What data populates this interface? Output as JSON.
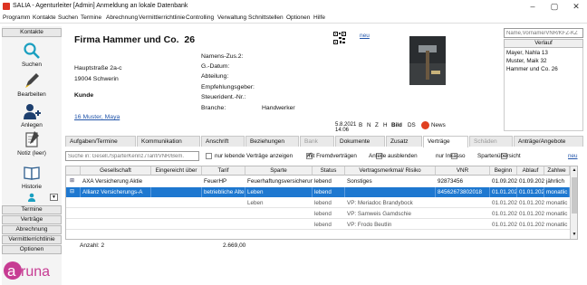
{
  "window": {
    "title": "SALIA - Agenturleiter [Admin] Anmeldung an lokale Datenbank"
  },
  "menu": [
    "Programm",
    "Kontakte",
    "Suchen",
    "Termine",
    "Abrechnung",
    "Vermittlerrichtlinie",
    "Controlling",
    "Verwaltung",
    "Schnittstellen",
    "Optionen",
    "Hilfe"
  ],
  "sidebar": {
    "top_header": "Kontakte",
    "items": [
      {
        "label": "Suchen",
        "icon": "search-icon"
      },
      {
        "label": "Bearbeiten",
        "icon": "pencil-icon"
      },
      {
        "label": "Anlegen",
        "icon": "add-person-icon"
      },
      {
        "label": "Notiz (leer)",
        "icon": "note-icon"
      },
      {
        "label": "Historie",
        "icon": "book-icon"
      }
    ],
    "bottom_buttons": [
      "Termine",
      "Verträge",
      "Abrechnung",
      "Vermittlerrichtlinie",
      "Optionen"
    ],
    "logo_text": "aruna"
  },
  "contact": {
    "company": "Firma Hammer und Co.",
    "number": "26",
    "street": "Hauptstraße 2a-c",
    "city": "19004 Schwerin",
    "role": "Kunde",
    "agent_link": "16 Muster, Maya",
    "fields": [
      "Namens-Zus.2:",
      "G.-Datum:",
      "Abteilung:",
      "Empfehlungsgeber:",
      "Steuerident.-Nr.:",
      "Branche:"
    ],
    "branche_value": "Handwerker",
    "date": "5.8.2021 14:06"
  },
  "photo": {
    "new_link": "neu",
    "buttons": [
      "B",
      "N",
      "Z",
      "H",
      "Bild",
      "DS"
    ],
    "news_label": "News"
  },
  "search": {
    "placeholder": "Name,Vorname/VNR/KFZ-KZ",
    "history_label": "Verlauf",
    "history": [
      "Mayer, Nahla  13",
      "Muster, Maik  32",
      "Hammer und Co.  26"
    ]
  },
  "tabs": [
    "Aufgaben/Termine",
    "Kommunikation",
    "Anschrift",
    "Beziehungen",
    "Bank",
    "Dokumente",
    "Zusatz",
    "Verträge",
    "Schäden",
    "Anträge/Angebote"
  ],
  "active_tab": "Verträge",
  "filters": {
    "search_placeholder": "Suche in: Gesell./Sparte/Kennz./Tarif/VNR/Bem.",
    "opt_active": "nur lebende Verträge anzeigen",
    "opt_fremd": "mit Fremdverträgen",
    "opt_anteile": "Anteile ausblenden",
    "opt_inkasso": "nur Inkasso",
    "opt_sparten": "Spartenübersicht",
    "new_link": "neu"
  },
  "grid": {
    "headers": [
      "Gesellschaft",
      "Eingereicht über",
      "Tarif",
      "Sparte",
      "Status",
      "Vertragsmerkmal/ Risiko",
      "VNR",
      "Beginn",
      "Ablauf",
      "Zahlwe"
    ],
    "rows": [
      {
        "gesellschaft": "AXA Versicherung Aktie",
        "eingereicht": "",
        "tarif": "FeuerHP",
        "sparte": "Feuerhaftungsversicherun",
        "status": "lebend",
        "merkmal": "Sonstiges",
        "vnr": "92873456",
        "beginn": "01.09.2020",
        "ablauf": "01.09.2021",
        "zahlweise": "jährlich",
        "selected": false,
        "sub": false
      },
      {
        "gesellschaft": "Allianz Versicherungs-A",
        "eingereicht": "",
        "tarif": "betriebliche Alte",
        "sparte": "Leben",
        "status": "lebend",
        "merkmal": "",
        "vnr": "84562673802018",
        "beginn": "01.01.2021",
        "ablauf": "01.01.2022",
        "zahlweise": "monatlic",
        "selected": true,
        "sub": false
      },
      {
        "gesellschaft": "",
        "eingereicht": "",
        "tarif": "",
        "sparte": "Leben",
        "status": "lebend",
        "merkmal": "VP: Meriadoc Brandybock",
        "vnr": "",
        "beginn": "01.01.2021",
        "ablauf": "01.01.2022",
        "zahlweise": "monatlic",
        "selected": false,
        "sub": true
      },
      {
        "gesellschaft": "",
        "eingereicht": "",
        "tarif": "",
        "sparte": "",
        "status": "lebend",
        "merkmal": "VP: Samweis Gamdschie",
        "vnr": "",
        "beginn": "01.01.2021",
        "ablauf": "01.01.2022",
        "zahlweise": "monatlic",
        "selected": false,
        "sub": true
      },
      {
        "gesellschaft": "",
        "eingereicht": "",
        "tarif": "",
        "sparte": "",
        "status": "lebend",
        "merkmal": "VP: Frodo Beutlin",
        "vnr": "",
        "beginn": "01.01.2021",
        "ablauf": "01.01.2022",
        "zahlweise": "monatlic",
        "selected": false,
        "sub": true
      }
    ],
    "footer_count_label": "Anzahl:",
    "footer_count": "2",
    "footer_sum": "2.669,00"
  },
  "colors": {
    "accent": "#1e78d0",
    "news": "#e04020",
    "logo": "#c73c93"
  }
}
